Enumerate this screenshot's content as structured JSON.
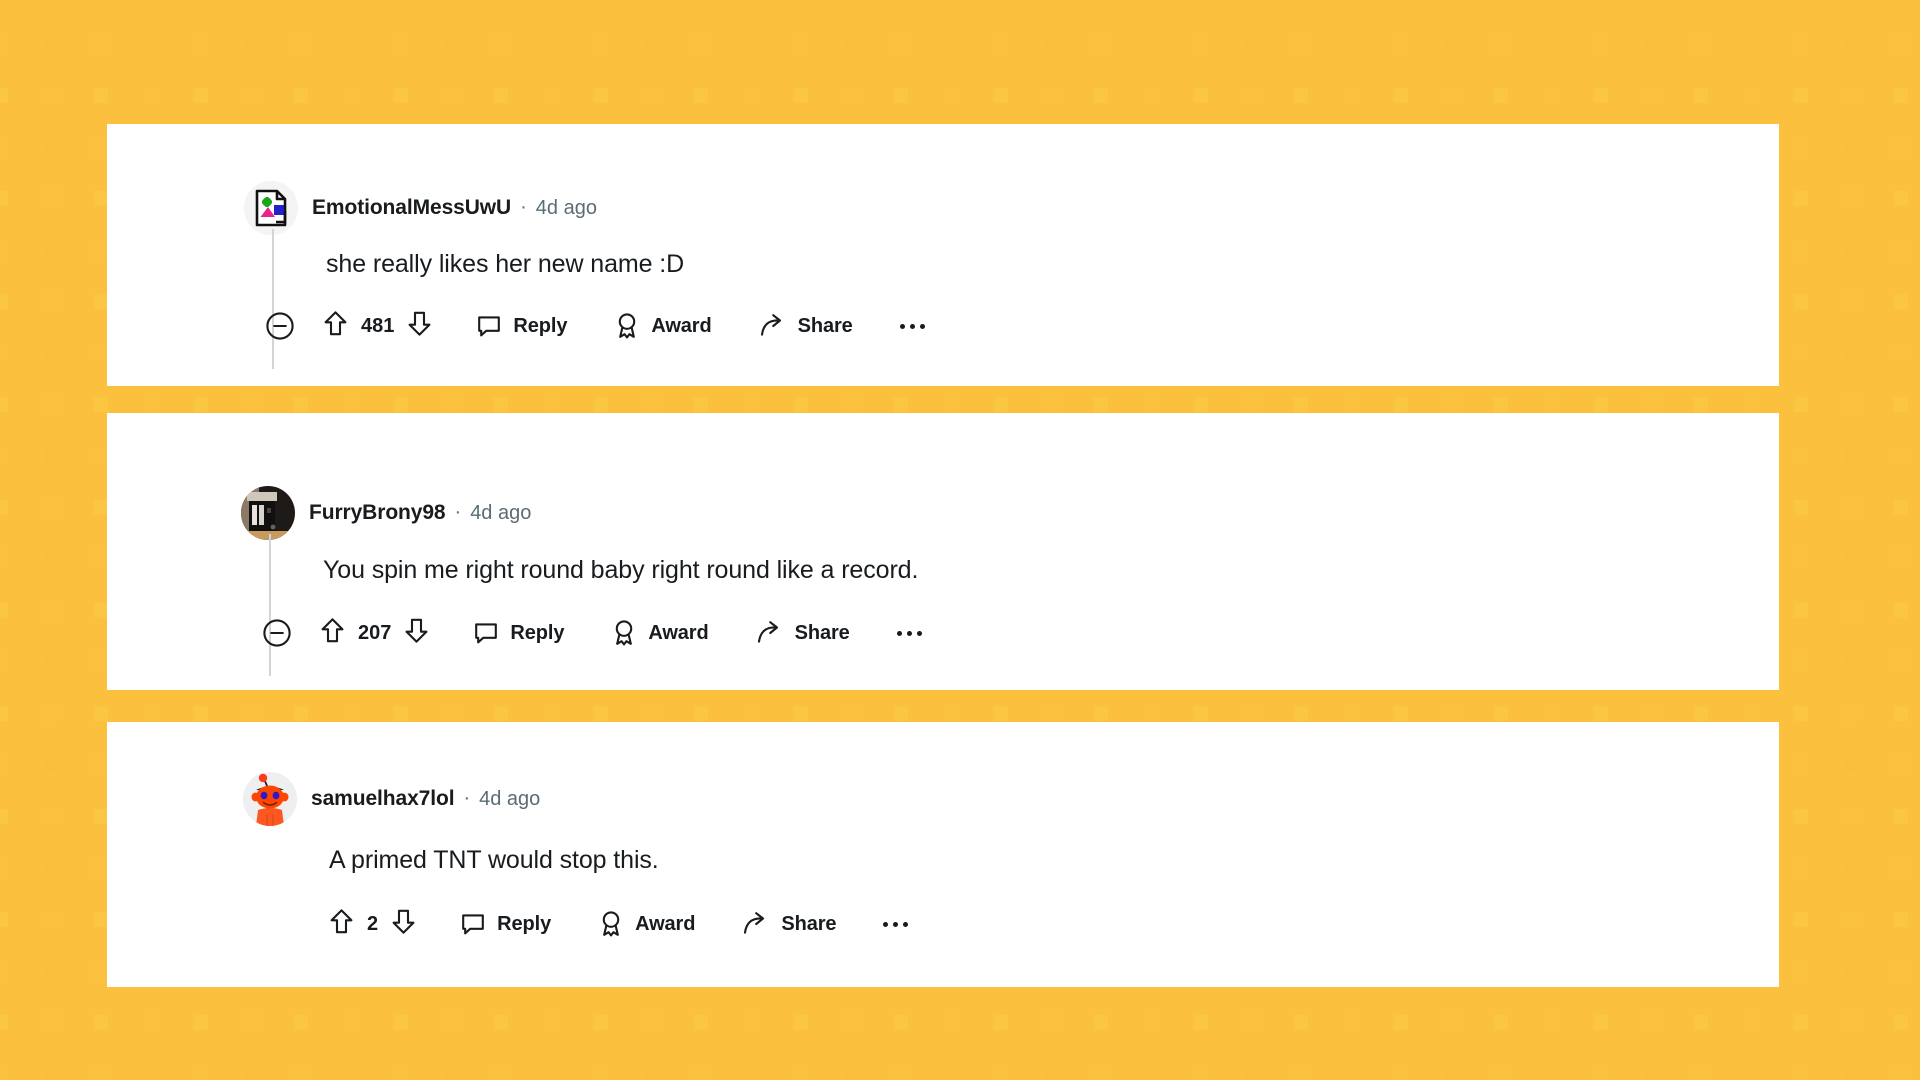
{
  "page": {
    "app": "reddit-comments",
    "background_pattern": "yellow-brick-tiles",
    "background_color": "#FFE259",
    "brick_color": "#FAC03D",
    "card_background": "#FFFFFF",
    "text_color": "#181C1F",
    "muted_text_color": "#5C6C74",
    "thread_line_color": "#D2D5D6"
  },
  "labels": {
    "reply": "Reply",
    "award": "Award",
    "share": "Share",
    "more": "•••",
    "separator": "·"
  },
  "comments": [
    {
      "id": "comment-1",
      "username": "EmotionalMessUwU",
      "separator": "·",
      "timestamp": "4d ago",
      "body": "she really likes her new name :D",
      "score": "481",
      "avatar_type": "broken-image-avatar",
      "has_collapse": true,
      "actions": {
        "reply": "Reply",
        "award": "Award",
        "share": "Share"
      }
    },
    {
      "id": "comment-2",
      "username": "FurryBrony98",
      "separator": "·",
      "timestamp": "4d ago",
      "body": "You spin me right round baby right round like a record.",
      "score": "207",
      "avatar_type": "dark-photo-avatar",
      "has_collapse": true,
      "actions": {
        "reply": "Reply",
        "award": "Award",
        "share": "Share"
      }
    },
    {
      "id": "comment-3",
      "username": "samuelhax7lol",
      "separator": "·",
      "timestamp": "4d ago",
      "body": "A primed TNT would stop this.",
      "score": "2",
      "avatar_type": "snoo-red-avatar",
      "has_collapse": false,
      "actions": {
        "reply": "Reply",
        "award": "Award",
        "share": "Share"
      }
    }
  ],
  "cutoff_row": {
    "score": "481"
  }
}
